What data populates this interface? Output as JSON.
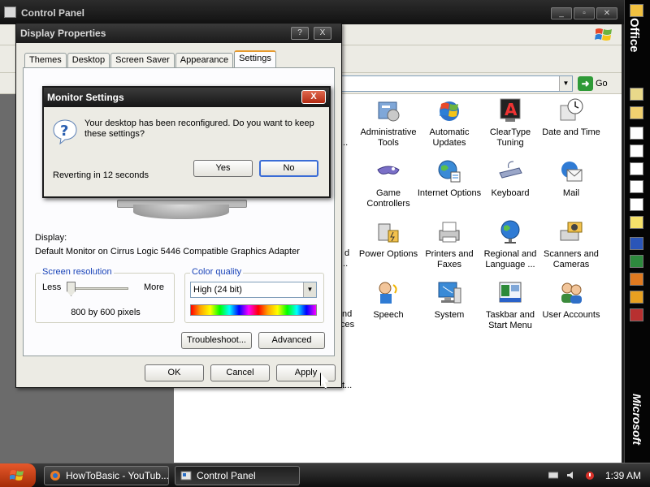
{
  "control_panel": {
    "title": "Control Panel",
    "go_label": "Go",
    "items": [
      {
        "label": "Administrative Tools",
        "icon": "admin-tools-icon"
      },
      {
        "label": "Automatic Updates",
        "icon": "automatic-updates-icon"
      },
      {
        "label": "ClearType Tuning",
        "icon": "cleartype-icon"
      },
      {
        "label": "Date and Time",
        "icon": "clock-icon"
      },
      {
        "label": "Game Controllers",
        "icon": "game-controller-icon"
      },
      {
        "label": "Internet Options",
        "icon": "globe-icon"
      },
      {
        "label": "Keyboard",
        "icon": "keyboard-icon"
      },
      {
        "label": "Mail",
        "icon": "mail-icon"
      },
      {
        "label": "Power Options",
        "icon": "power-icon"
      },
      {
        "label": "Printers and Faxes",
        "icon": "printer-icon"
      },
      {
        "label": "Regional and Language ...",
        "icon": "globe-regional-icon"
      },
      {
        "label": "Scanners and Cameras",
        "icon": "camera-icon"
      },
      {
        "label": "Speech",
        "icon": "speech-icon"
      },
      {
        "label": "System",
        "icon": "system-icon"
      },
      {
        "label": "Taskbar and Start Menu",
        "icon": "taskbar-icon"
      },
      {
        "label": "User Accounts",
        "icon": "user-accounts-icon"
      }
    ],
    "partial_texts": {
      "p1": "...",
      "p2": "d",
      "p3": "...",
      "p4": "nd",
      "p5": "ces",
      "p6": "t..."
    }
  },
  "display_properties": {
    "title": "Display Properties",
    "help_label": "?",
    "close_label": "X",
    "tabs": [
      "Themes",
      "Desktop",
      "Screen Saver",
      "Appearance",
      "Settings"
    ],
    "active_tab": "Settings",
    "display_label": "Display:",
    "display_value": "Default Monitor on Cirrus Logic 5446 Compatible Graphics Adapter",
    "resolution": {
      "title": "Screen resolution",
      "less": "Less",
      "more": "More",
      "value": "800 by 600 pixels",
      "slider_position": 0
    },
    "color_quality": {
      "title": "Color quality",
      "selected": "High (24 bit)"
    },
    "buttons": {
      "troubleshoot": "Troubleshoot...",
      "advanced": "Advanced",
      "ok": "OK",
      "cancel": "Cancel",
      "apply": "Apply"
    }
  },
  "monitor_settings": {
    "title": "Monitor Settings",
    "close_label": "X",
    "message": "Your desktop has been reconfigured.  Do you want to keep these settings?",
    "countdown": "Reverting in 12 seconds",
    "yes": "Yes",
    "no": "No"
  },
  "office_bar": {
    "logo": "Office",
    "brand": "Microsoft"
  },
  "taskbar": {
    "tasks": [
      {
        "label": "HowToBasic - YouTub...",
        "icon": "browser-icon"
      },
      {
        "label": "Control Panel",
        "icon": "control-panel-icon"
      }
    ],
    "time": "1:39 AM"
  },
  "colors": {
    "accent_tab": "#e69a2e",
    "group_title": "#1a44b8",
    "close_red": "#b22a12"
  }
}
